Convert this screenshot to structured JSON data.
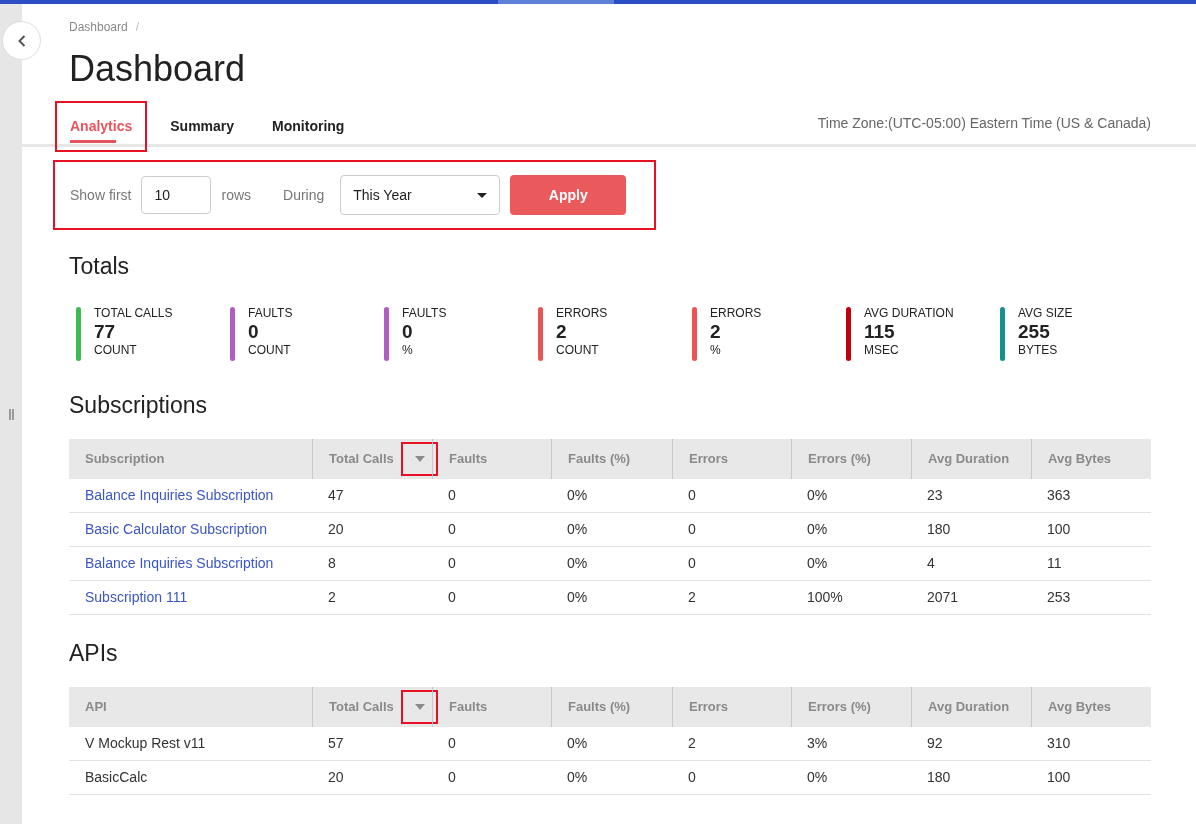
{
  "breadcrumb": [
    "Dashboard",
    "/"
  ],
  "title": "Dashboard",
  "tabs": [
    {
      "label": "Analytics",
      "selected": true,
      "highlighted": true
    },
    {
      "label": "Summary",
      "selected": false,
      "highlighted": false
    },
    {
      "label": "Monitoring",
      "selected": false,
      "highlighted": false
    }
  ],
  "time_zone": "Time Zone:(UTC-05:00) Eastern Time (US & Canada)",
  "filter": {
    "highlighted": true,
    "show_first_label": "Show first",
    "rows_value": "10",
    "rows_label": "rows",
    "during_label": "During",
    "period": "This Year",
    "apply": "Apply"
  },
  "totals": {
    "heading": "Totals",
    "items": [
      {
        "label": "TOTAL CALLS",
        "value": "77",
        "unit": "COUNT",
        "color": "#3cba54"
      },
      {
        "label": "FAULTS",
        "value": "0",
        "unit": "COUNT",
        "color": "#b05cc0"
      },
      {
        "label": "FAULTS",
        "value": "0",
        "unit": "%",
        "color": "#b05cc0"
      },
      {
        "label": "ERRORS",
        "value": "2",
        "unit": "COUNT",
        "color": "#ea5455"
      },
      {
        "label": "ERRORS",
        "value": "2",
        "unit": "%",
        "color": "#ea5455"
      },
      {
        "label": "AVG DURATION",
        "value": "115",
        "unit": "MSEC",
        "color": "#c0000c"
      },
      {
        "label": "AVG SIZE",
        "value": "255",
        "unit": "BYTES",
        "color": "#178f8a"
      }
    ]
  },
  "tables": [
    {
      "heading": "Subscriptions",
      "link_first": true,
      "columns": [
        {
          "label": "Subscription",
          "sorted": false
        },
        {
          "label": "Total Calls",
          "sorted": true
        },
        {
          "label": "Faults",
          "sorted": false
        },
        {
          "label": "Faults (%)",
          "sorted": false
        },
        {
          "label": "Errors",
          "sorted": false
        },
        {
          "label": "Errors (%)",
          "sorted": false
        },
        {
          "label": "Avg Duration",
          "sorted": false
        },
        {
          "label": "Avg Bytes",
          "sorted": false
        }
      ],
      "rows": [
        [
          "Balance Inquiries Subscription",
          "47",
          "0",
          "0%",
          "0",
          "0%",
          "23",
          "363"
        ],
        [
          "Basic Calculator Subscription",
          "20",
          "0",
          "0%",
          "0",
          "0%",
          "180",
          "100"
        ],
        [
          "Balance Inquiries Subscription",
          "8",
          "0",
          "0%",
          "0",
          "0%",
          "4",
          "11"
        ],
        [
          "Subscription 111",
          "2",
          "0",
          "0%",
          "2",
          "100%",
          "2071",
          "253"
        ]
      ]
    },
    {
      "heading": "APIs",
      "link_first": false,
      "columns": [
        {
          "label": "API",
          "sorted": false
        },
        {
          "label": "Total Calls",
          "sorted": true
        },
        {
          "label": "Faults",
          "sorted": false
        },
        {
          "label": "Faults (%)",
          "sorted": false
        },
        {
          "label": "Errors",
          "sorted": false
        },
        {
          "label": "Errors (%)",
          "sorted": false
        },
        {
          "label": "Avg Duration",
          "sorted": false
        },
        {
          "label": "Avg Bytes",
          "sorted": false
        }
      ],
      "rows": [
        [
          "V Mockup Rest v11",
          "57",
          "0",
          "0%",
          "2",
          "3%",
          "92",
          "310"
        ],
        [
          "BasicCalc",
          "20",
          "0",
          "0%",
          "0",
          "0%",
          "180",
          "100"
        ]
      ]
    }
  ]
}
